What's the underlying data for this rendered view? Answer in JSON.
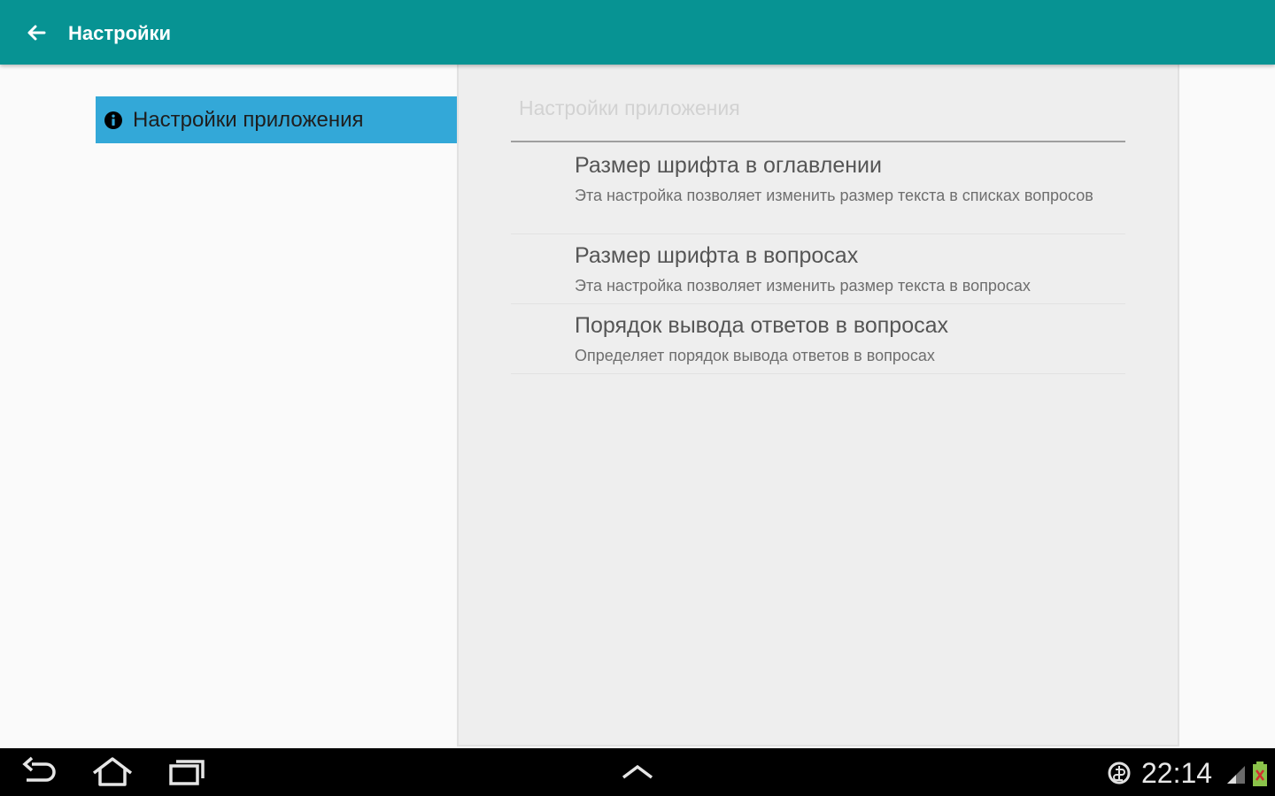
{
  "appbar": {
    "title": "Настройки",
    "color": "#079393"
  },
  "headers": [
    {
      "label": "Настройки приложения",
      "icon": "info-icon",
      "selected": true
    }
  ],
  "preferences": {
    "category_title": "Настройки приложения",
    "items": [
      {
        "title": "Размер шрифта в оглавлении",
        "summary": "Эта настройка позволяет изменить размер текста в списках вопросов"
      },
      {
        "title": "Размер шрифта в вопросах",
        "summary": "Эта настройка позволяет изменить размер текста в вопросах"
      },
      {
        "title": "Порядок вывода ответов в вопросах",
        "summary": "Определяет порядок вывода ответов в вопросах"
      }
    ]
  },
  "system_bar": {
    "time": "22:14",
    "icons": [
      "back-icon",
      "home-icon",
      "recent-apps-icon",
      "chevron-up-icon",
      "data-saver-icon",
      "signal-icon",
      "battery-icon"
    ]
  }
}
